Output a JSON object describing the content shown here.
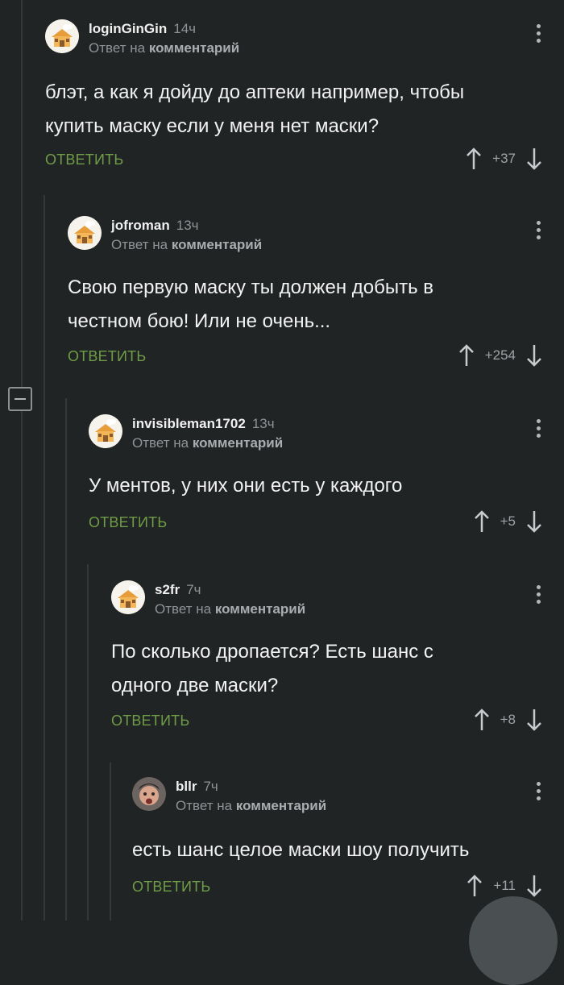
{
  "reply_to_prefix": "Ответ на",
  "reply_to_target": "комментарий",
  "reply_label": "ОТВЕТИТЬ",
  "colors": {
    "background": "#212425",
    "reply_green": "#6f9c46",
    "muted": "#8f9396"
  },
  "comments": [
    {
      "username": "loginGinGin",
      "time": "14ч",
      "text_lines": [
        "блэт, а как я дойду до аптеки например, чтобы",
        "купить маску если у меня нет маски?"
      ],
      "votes": "+37",
      "avatar": "house-avatar"
    },
    {
      "username": "jofroman",
      "time": "13ч",
      "text_lines": [
        "Свою первую маску ты должен добыть в",
        "честном бою! Или не очень..."
      ],
      "votes": "+254",
      "avatar": "house-avatar"
    },
    {
      "username": "invisibleman1702",
      "time": "13ч",
      "text_lines": [
        "У ментов, у них они есть у каждого"
      ],
      "votes": "+5",
      "avatar": "house-avatar"
    },
    {
      "username": "s2fr",
      "time": "7ч",
      "text_lines": [
        "По сколько дропается? Есть шанс с",
        "одного две маски?"
      ],
      "votes": "+8",
      "avatar": "house-avatar"
    },
    {
      "username": "bllr",
      "time": "7ч",
      "text_lines": [
        "есть шанс целое маски шоу получить"
      ],
      "votes": "+11",
      "avatar": "face-avatar"
    }
  ]
}
